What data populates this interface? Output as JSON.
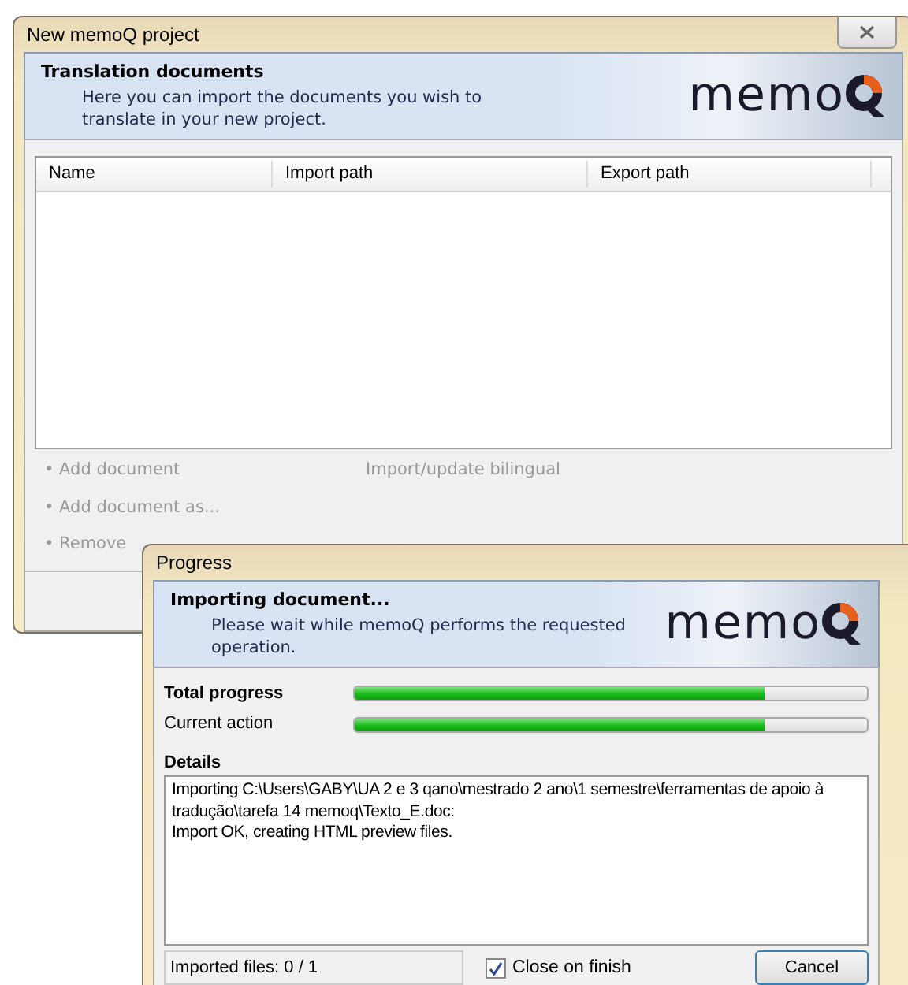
{
  "project_window": {
    "title": "New memoQ project",
    "header": {
      "title": "Translation documents",
      "description": "Here you can import the documents you wish to translate in your new project.",
      "logo_text": "memo"
    },
    "table": {
      "columns": [
        "Name",
        "Import path",
        "Export path"
      ]
    },
    "actions": [
      {
        "label": "• Add document",
        "disabled": true
      },
      {
        "label": "• Add document as...",
        "disabled": true
      },
      {
        "label": "• Remove",
        "disabled": true
      }
    ],
    "side_action": {
      "label": "Import/update bilingual",
      "disabled": true
    }
  },
  "progress_window": {
    "title": "Progress",
    "header": {
      "title": "Importing document...",
      "description": "Please wait while memoQ performs the requested operation.",
      "logo_text": "memo"
    },
    "bars": [
      {
        "label": "Total progress",
        "bold": true,
        "level": 0.8
      },
      {
        "label": "Current action",
        "bold": false,
        "level": 0.8
      }
    ],
    "details_label": "Details",
    "details_lines": [
      "Importing C:\\Users\\GABY\\UA 2 e 3 qano\\mestrado 2 ano\\1 semestre\\ferramentas de apoio à tradução\\tarefa 14 memoq\\Texto_E.doc:",
      "Import OK, creating HTML preview files."
    ],
    "status": "Imported files: 0 / 1",
    "close_on_finish": {
      "label": "Close on finish",
      "checked": true
    },
    "cancel": "Cancel"
  }
}
